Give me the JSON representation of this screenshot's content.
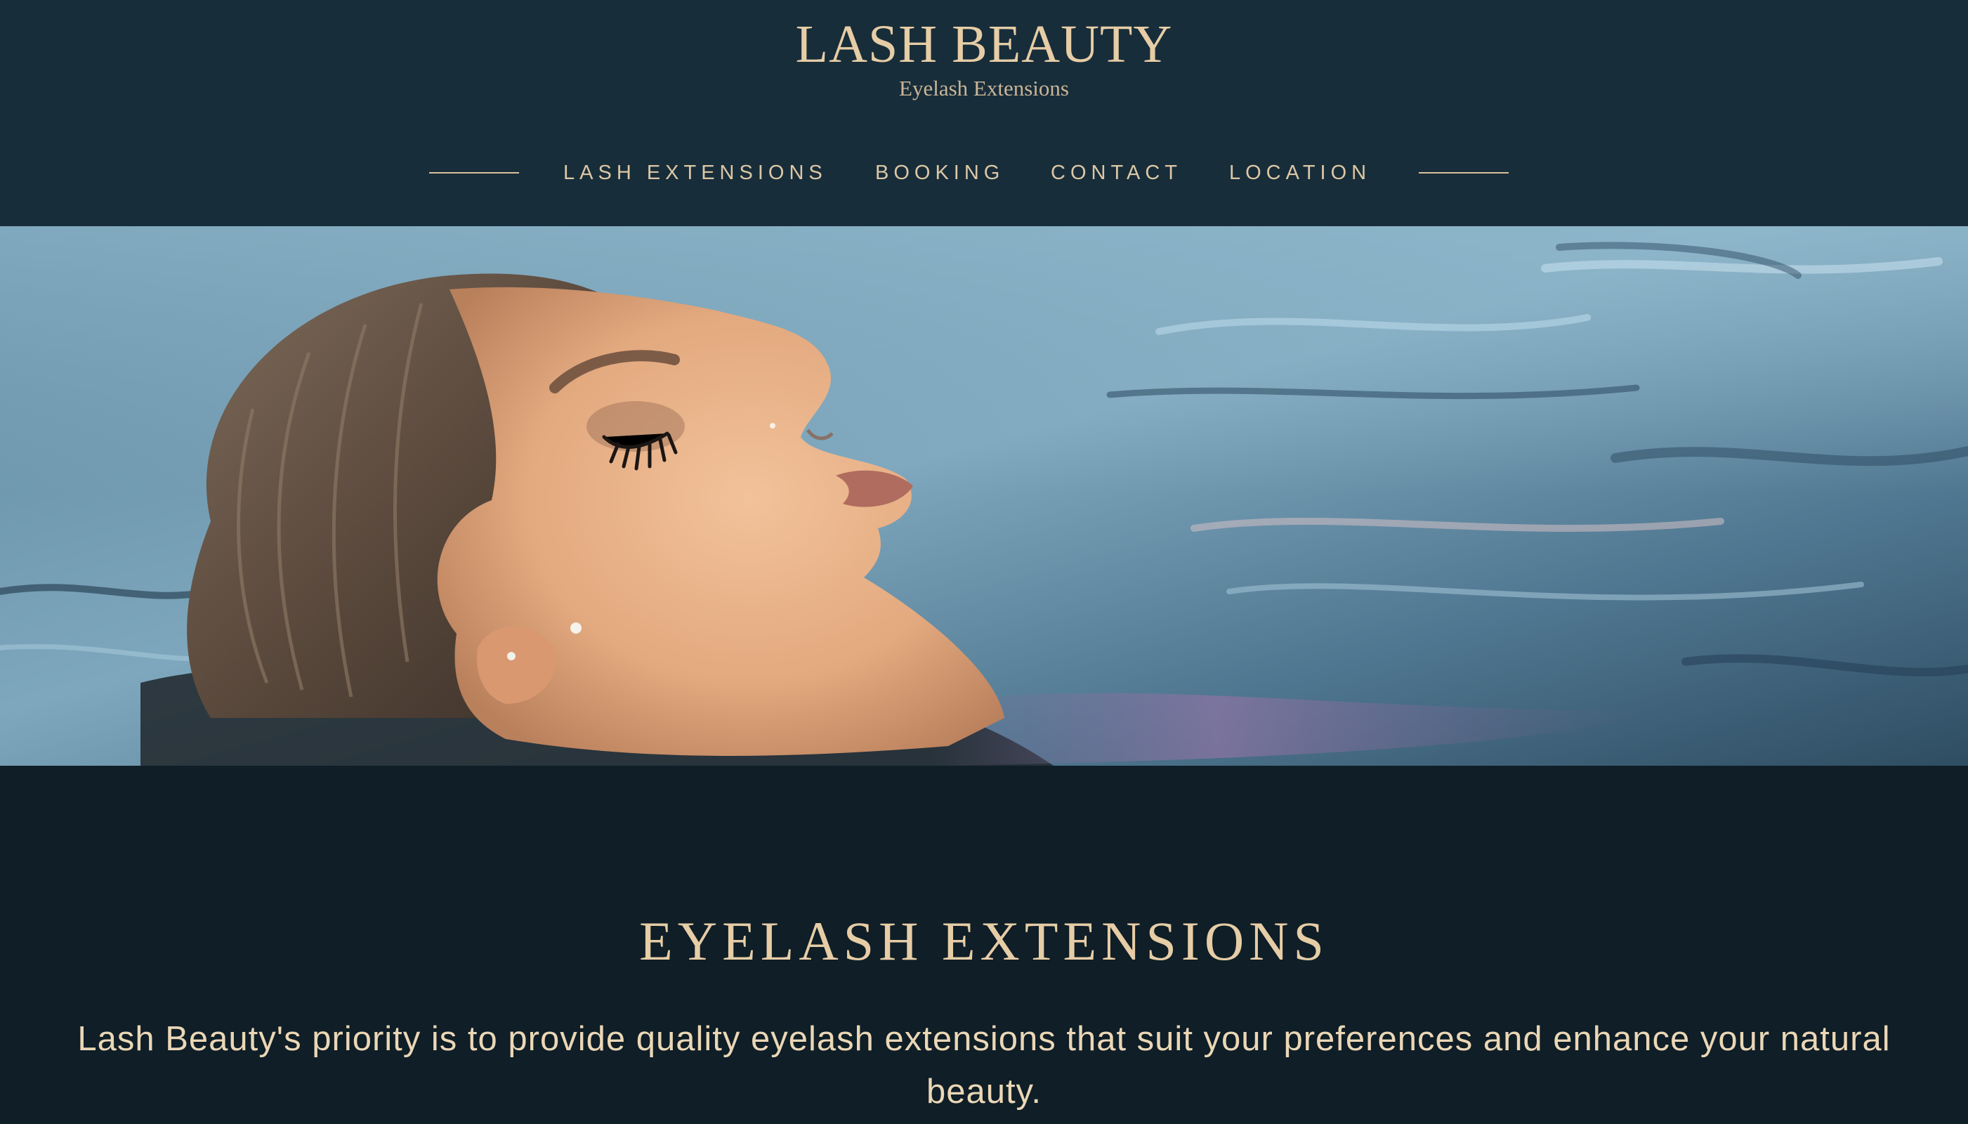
{
  "header": {
    "brand_title": "LASH BEAUTY",
    "brand_subtitle": "Eyelash Extensions"
  },
  "nav": {
    "items": [
      {
        "label": "LASH EXTENSIONS"
      },
      {
        "label": "BOOKING"
      },
      {
        "label": "CONTACT"
      },
      {
        "label": "LOCATION"
      }
    ]
  },
  "hero": {
    "image": "hero-photo"
  },
  "main": {
    "section_title": "EYELASH EXTENSIONS",
    "section_body": "Lash Beauty's priority is to provide quality eyelash extensions that suit your preferences and enhance your natural beauty."
  },
  "colors": {
    "header_bg": "#182d3a",
    "page_bg": "#0f1e27",
    "accent_gold": "#e6cda6"
  }
}
